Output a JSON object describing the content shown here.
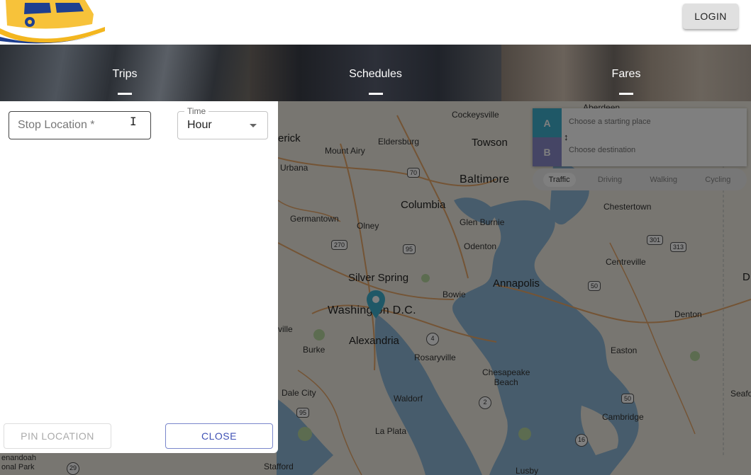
{
  "header": {
    "login_label": "LOGIN"
  },
  "nav": {
    "tabs": [
      {
        "label": "Trips"
      },
      {
        "label": "Schedules"
      },
      {
        "label": "Fares"
      }
    ]
  },
  "panel": {
    "stop_location_placeholder": "Stop Location *",
    "time_label": "Time",
    "time_value": "Hour",
    "pin_label": "PIN LOCATION",
    "close_label": "CLOSE"
  },
  "directions": {
    "a_label": "A",
    "b_label": "B",
    "start_placeholder": "Choose a starting place",
    "dest_placeholder": "Choose destination",
    "profiles": [
      "Traffic",
      "Driving",
      "Walking",
      "Cycling"
    ],
    "active_profile": "Traffic"
  },
  "map": {
    "places": {
      "cockeysville": "Cockeysville",
      "aberdeen": "Aberdeen",
      "erick": "erick",
      "eldersburg": "Eldersburg",
      "towson": "Towson",
      "mount_airy": "Mount Airy",
      "urbana": "Urbana",
      "baltimore": "Baltimore",
      "columbia": "Columbia",
      "chestertown": "Chestertown",
      "germantown": "Germantown",
      "glen_burnie": "Glen Burnie",
      "olney": "Olney",
      "odenton": "Odenton",
      "centreville": "Centreville",
      "silver_spring": "Silver Spring",
      "bowie": "Bowie",
      "annapolis": "Annapolis",
      "washington": "Washington D.C.",
      "ville": "ville",
      "denton": "Denton",
      "alexandria": "Alexandria",
      "burke": "Burke",
      "rosaryville": "Rosaryville",
      "easton": "Easton",
      "chesapeake_beach": "Chesapeake\nBeach",
      "dale_city": "Dale City",
      "waldorf": "Waldorf",
      "cambridge": "Cambridge",
      "seaford": "Seafo",
      "la_plata": "La Plata",
      "enandoah": "enandoah\nonal Park",
      "stafford": "Stafford",
      "lusby": "Lusby",
      "d": "D"
    },
    "shields": [
      "70",
      "270",
      "95",
      "301",
      "313",
      "50",
      "4",
      "2",
      "50",
      "95",
      "16",
      "29"
    ]
  }
}
